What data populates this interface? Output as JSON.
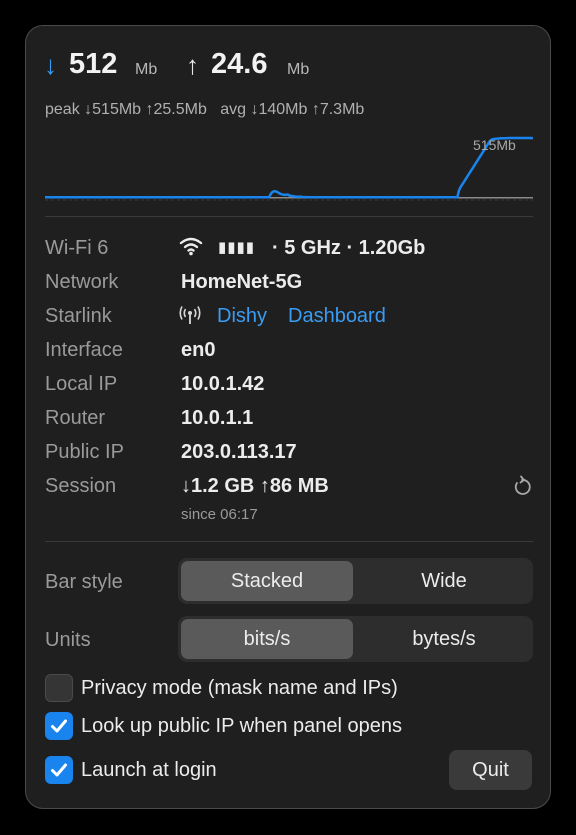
{
  "header": {
    "download": {
      "arrow": "↓",
      "value": "512",
      "unit": "Mb",
      "color": "#3a9cf2"
    },
    "upload": {
      "arrow": "↑",
      "value": "24.6",
      "unit": "Mb"
    },
    "stats": "peak ↓515Mb ↑25.5Mb   avg ↓140Mb ↑7.3Mb"
  },
  "graph": {
    "peak_label": "515Mb",
    "download_color": "#1a84ee",
    "upload_color": "#8a8a8a",
    "scale_max": 515,
    "download_series": [
      6,
      6,
      6,
      6,
      6,
      6,
      6,
      6,
      6,
      6,
      6,
      6,
      6,
      6,
      6,
      6,
      6,
      6,
      6,
      6,
      6,
      6,
      6,
      6,
      6,
      6,
      6,
      6,
      6,
      6,
      6,
      6,
      6,
      6,
      6,
      6,
      6,
      6,
      6,
      6,
      6,
      6,
      6,
      6,
      6,
      6,
      6,
      6,
      6,
      6,
      6,
      6,
      6,
      6,
      6,
      6,
      6,
      6,
      6,
      6,
      6,
      6,
      6,
      6,
      6,
      6,
      6,
      6,
      6,
      6,
      6,
      6,
      6,
      6,
      6,
      6,
      6,
      6,
      6,
      6,
      6,
      6,
      6,
      6,
      6,
      6,
      6,
      6,
      6,
      6,
      6,
      6,
      6,
      6,
      6,
      6,
      6,
      6,
      6,
      6,
      6,
      6,
      6,
      6,
      6,
      6,
      6,
      6,
      6,
      6,
      6,
      6,
      6,
      6,
      6,
      6,
      6,
      6,
      6,
      6,
      6,
      6,
      6,
      6,
      6,
      6,
      6,
      6,
      6,
      6,
      6,
      6,
      6,
      6,
      6,
      6,
      6,
      6,
      6,
      6,
      6,
      6,
      6,
      6,
      6,
      6,
      6,
      6,
      6,
      6,
      6,
      6,
      30,
      48,
      56,
      58,
      55,
      48,
      40,
      34,
      30,
      28,
      26,
      30,
      28,
      20,
      18,
      16,
      14,
      12,
      10,
      10,
      12,
      10,
      8,
      8,
      8,
      8,
      6,
      6,
      6,
      6,
      6,
      6,
      6,
      6,
      6,
      6,
      6,
      6,
      6,
      6,
      6,
      6,
      6,
      6,
      6,
      6,
      6,
      6,
      6,
      6,
      6,
      6,
      6,
      6,
      6,
      6,
      6,
      6,
      6,
      6,
      6,
      6,
      6,
      6,
      6,
      6,
      6,
      6,
      6,
      6,
      6,
      6,
      6,
      6,
      6,
      6,
      6,
      6,
      6,
      6,
      6,
      6,
      6,
      6,
      6,
      6,
      6,
      6,
      6,
      6,
      6,
      6,
      6,
      6,
      6,
      6,
      6,
      6,
      6,
      6,
      6,
      6,
      6,
      6,
      6,
      6,
      6,
      6,
      6,
      6,
      6,
      6,
      6,
      6,
      6,
      6,
      6,
      6,
      6,
      6,
      6,
      6,
      6,
      6,
      6,
      6,
      6,
      60,
      90,
      110,
      130,
      150,
      170,
      190,
      210,
      230,
      250,
      270,
      290,
      310,
      330,
      350,
      370,
      390,
      410,
      430,
      450,
      470,
      490,
      500,
      505,
      507,
      508,
      510,
      511,
      512,
      512,
      513,
      513,
      514,
      514,
      515,
      515,
      515,
      515,
      515,
      515,
      515,
      515,
      515,
      515,
      515,
      515,
      515,
      515,
      515,
      515,
      512
    ],
    "upload_series": [
      2,
      2,
      2,
      2,
      2,
      2,
      2,
      2,
      2,
      2,
      2,
      2,
      2,
      2,
      2,
      2,
      2,
      2,
      2,
      2,
      2,
      2,
      2,
      2,
      2,
      2,
      2,
      2,
      2,
      2,
      2,
      2,
      2,
      2,
      2,
      2,
      2,
      2,
      2,
      2,
      2,
      2,
      2,
      2,
      2,
      2,
      2,
      2,
      2,
      2,
      2,
      2,
      2,
      2,
      2,
      2,
      2,
      2,
      2,
      2,
      2,
      2,
      2,
      2,
      2,
      2,
      2,
      2,
      2,
      2,
      2,
      2,
      2,
      2,
      2,
      2,
      2,
      2,
      2,
      2,
      2,
      2,
      2,
      2,
      2,
      2,
      2,
      2,
      2,
      2,
      2,
      2,
      2,
      2,
      2,
      2,
      2,
      2,
      2,
      2,
      2,
      2,
      2,
      2,
      2,
      2,
      2,
      2,
      2,
      2,
      2,
      2,
      2,
      2,
      2,
      2,
      2,
      2,
      2,
      2,
      2,
      2,
      2,
      2,
      2,
      2,
      2,
      2,
      2,
      2,
      2,
      2,
      2,
      2,
      2,
      2,
      2,
      2,
      2,
      2,
      2,
      2,
      2,
      2,
      2,
      2,
      2,
      2,
      2,
      2,
      2,
      2,
      2,
      2,
      2,
      2,
      2,
      2,
      2,
      2,
      2,
      2,
      2,
      2,
      2,
      2,
      2,
      2,
      2,
      2,
      2,
      2,
      2,
      2,
      2,
      2,
      2,
      2,
      2,
      2,
      2,
      2,
      2,
      2,
      2,
      2,
      2,
      2,
      2,
      2,
      2,
      2,
      2,
      2,
      2,
      2,
      2,
      2,
      2,
      2,
      2,
      2,
      2,
      2,
      2,
      2,
      2,
      2,
      2,
      2,
      2,
      2,
      2,
      2,
      2,
      2,
      2,
      2,
      2,
      2,
      2,
      2,
      2,
      2,
      2,
      2,
      2,
      2,
      2,
      2,
      2,
      2,
      2,
      2,
      2,
      2,
      2,
      2,
      2,
      2,
      2,
      2,
      2,
      2,
      2,
      2,
      2,
      2,
      2,
      2,
      2,
      2,
      2,
      2,
      2,
      2,
      2,
      2,
      2,
      2,
      2,
      2,
      2,
      2,
      2,
      2,
      2,
      2,
      2,
      2,
      2,
      2,
      2,
      2,
      2,
      2,
      2,
      2,
      2,
      2,
      2,
      2,
      2,
      2,
      2,
      2,
      2,
      2,
      2,
      2,
      2,
      2,
      2,
      2,
      2,
      2,
      2,
      2,
      2,
      2,
      2,
      2,
      2,
      2,
      2,
      2,
      2,
      2,
      2,
      2,
      2,
      2,
      2,
      2,
      2,
      2,
      2,
      2,
      2,
      2,
      2,
      2,
      2,
      2,
      2,
      2,
      2,
      2,
      2,
      2,
      2,
      2,
      2,
      2,
      2,
      2,
      2,
      2,
      2,
      2,
      2,
      2,
      2,
      2,
      2,
      2,
      2,
      2,
      2,
      2,
      2,
      2,
      2,
      2,
      2,
      2,
      2,
      2,
      2,
      2,
      2,
      2,
      2,
      2,
      2,
      2,
      2,
      2,
      2,
      2,
      2,
      2,
      2,
      2,
      2,
      2,
      2,
      2,
      2,
      2,
      2,
      2,
      2,
      2,
      2,
      2,
      2,
      2,
      2,
      2,
      2,
      2,
      2,
      2,
      2,
      2,
      2,
      2,
      2,
      2,
      2,
      2,
      2,
      2,
      2,
      2,
      2,
      2,
      2,
      2,
      2,
      2,
      2,
      2,
      2,
      2,
      2,
      2,
      2,
      2,
      2,
      2,
      2,
      2,
      2,
      2,
      2,
      2,
      2,
      2,
      2,
      2,
      2,
      2,
      2,
      2,
      2,
      2,
      2,
      2,
      2,
      2,
      2,
      2,
      2,
      2,
      2,
      2,
      2,
      2,
      2,
      2,
      2,
      2,
      2,
      2,
      2,
      2,
      2,
      2,
      2,
      2,
      2,
      2,
      2,
      2,
      2
    ]
  },
  "info": {
    "wifi": {
      "label": "Wi-Fi 6",
      "signal_bars": "▮▮▮▮",
      "value": "· 5 GHz · 1.20Gb",
      "icon": "wifi-icon"
    },
    "network": {
      "label": "Network",
      "value": "HomeNet-5G"
    },
    "starlink": {
      "label": "Starlink",
      "icon": "antenna-icon",
      "dishy": "Dishy",
      "dashboard": "Dashboard"
    },
    "interface": {
      "label": "Interface",
      "value": "en0"
    },
    "local_ip": {
      "label": "Local IP",
      "value": "10.0.1.42"
    },
    "router": {
      "label": "Router",
      "value": "10.0.1.1"
    },
    "public_ip": {
      "label": "Public IP",
      "value": "203.0.113.17"
    },
    "session": {
      "label": "Session",
      "value": "↓1.2 GB ↑86 MB",
      "since": "since 06:17",
      "icon": "reset-icon"
    }
  },
  "settings": {
    "bar_style": {
      "label": "Bar style",
      "options": [
        "Stacked",
        "Wide"
      ],
      "selected": "Stacked"
    },
    "units": {
      "label": "Units",
      "options": [
        "bits/s",
        "bytes/s"
      ],
      "selected": "bits/s"
    },
    "privacy": {
      "label": "Privacy mode (mask name and IPs)",
      "checked": false
    },
    "lookup_ip": {
      "label": "Look up public IP when panel opens",
      "checked": true
    },
    "launch": {
      "label": "Launch at login",
      "checked": true
    },
    "quit_label": "Quit"
  }
}
